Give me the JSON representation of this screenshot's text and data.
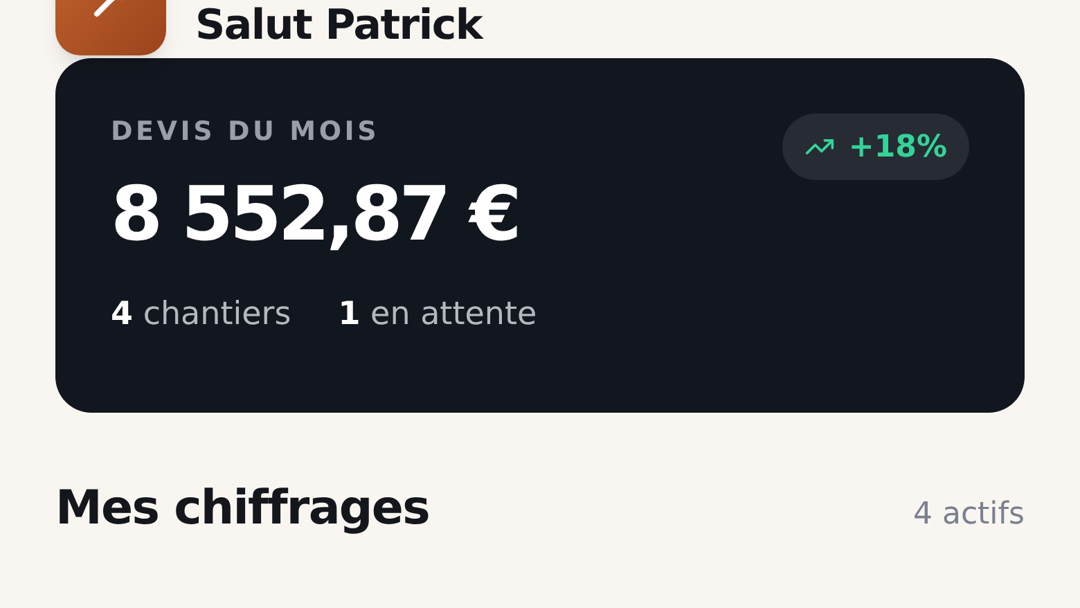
{
  "header": {
    "greeting": "Salut Patrick"
  },
  "summary": {
    "label": "DEVIS DU MOIS",
    "amount": "8 552,87 €",
    "trend": "+18%",
    "stats": [
      "**4** chantiers",
      "**1** en attente"
    ]
  },
  "section": {
    "title": "Mes chiffrages",
    "count": "4 actifs"
  }
}
